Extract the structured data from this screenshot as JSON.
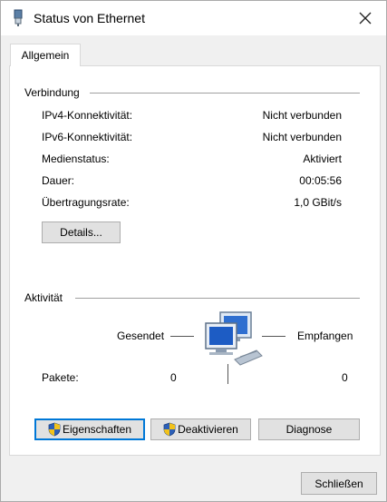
{
  "window": {
    "title": "Status von Ethernet"
  },
  "tabs": [
    {
      "label": "Allgemein"
    }
  ],
  "connection": {
    "group_label": "Verbindung",
    "rows": [
      {
        "label": "IPv4-Konnektivität:",
        "value": "Nicht verbunden"
      },
      {
        "label": "IPv6-Konnektivität:",
        "value": "Nicht verbunden"
      },
      {
        "label": "Medienstatus:",
        "value": "Aktiviert"
      },
      {
        "label": "Dauer:",
        "value": "00:05:56"
      },
      {
        "label": "Übertragungsrate:",
        "value": "1,0 GBit/s"
      }
    ],
    "details_button": "Details..."
  },
  "activity": {
    "group_label": "Aktivität",
    "sent_label": "Gesendet",
    "received_label": "Empfangen",
    "packets_label": "Pakete:",
    "packets_sent": "0",
    "packets_received": "0"
  },
  "buttons": {
    "properties": "Eigenschaften",
    "disable": "Deaktivieren",
    "diagnose": "Diagnose",
    "close": "Schließen"
  },
  "icons": {
    "title": "ethernet-adapter-icon",
    "close": "close-icon",
    "network": "network-computers-icon",
    "shield": "uac-shield-icon"
  },
  "colors": {
    "focus": "#0078d7",
    "button_face": "#e1e1e1",
    "panel": "#ffffff"
  }
}
